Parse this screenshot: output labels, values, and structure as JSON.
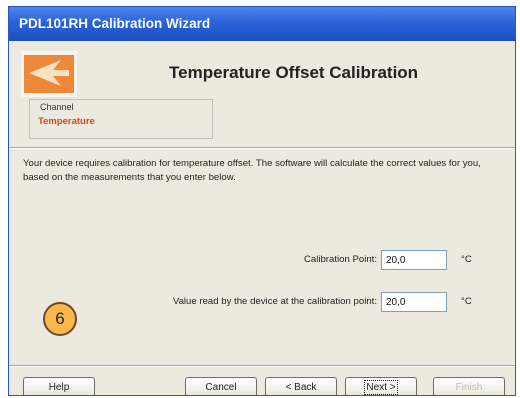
{
  "window": {
    "title": "PDL101RH Calibration Wizard"
  },
  "header": {
    "title": "Temperature Offset Calibration",
    "logo_icon": "orange-arrow-logo-icon"
  },
  "channel": {
    "label": "Channel",
    "value": "Temperature"
  },
  "description": "Your device requires calibration for temperature offset. The software will calculate the correct values for you, based on the measurements that you enter below.",
  "fields": {
    "calibration_point": {
      "label": "Calibration Point:",
      "value": "20,0",
      "unit": "°C"
    },
    "device_value": {
      "label": "Value read by the device at the calibration point:",
      "value": "20,0",
      "unit": "°C"
    }
  },
  "step_badge": "6",
  "buttons": {
    "help": "Help",
    "cancel": "Cancel",
    "back": "< Back",
    "next": "Next >",
    "finish": "Finish"
  },
  "colors": {
    "titlebar": "#2a63d8",
    "channel_value": "#d04a1e",
    "badge": "#fbb74a",
    "logo": "#f0883a"
  }
}
